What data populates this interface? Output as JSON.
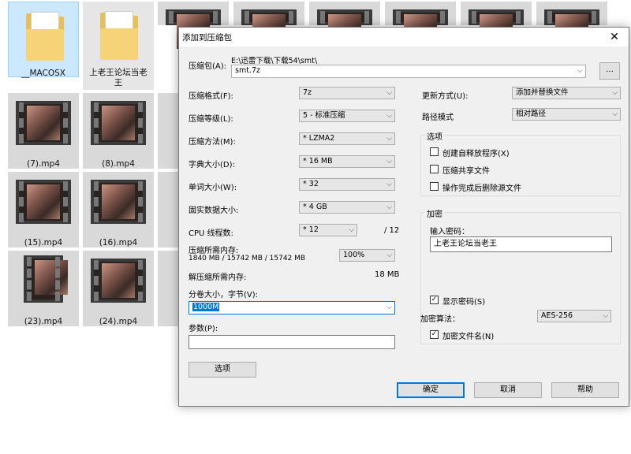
{
  "explorer": {
    "tiles": [
      {
        "name": "__MACOSX"
      },
      {
        "name": "上老王论坛当老王"
      },
      {
        "name": ""
      },
      {
        "name": ""
      },
      {
        "name": ""
      },
      {
        "name": ""
      },
      {
        "name": ""
      },
      {
        "name": ""
      },
      {
        "name": "(7).mp4"
      },
      {
        "name": "(8).mp4"
      },
      {
        "name": "(15).mp4"
      },
      {
        "name": "(16).mp4"
      },
      {
        "name": "(23).mp4"
      },
      {
        "name": "(24).mp4"
      }
    ]
  },
  "dialog": {
    "title": "添加到压缩包",
    "close_glyph": "✕",
    "archive_label": "压缩包(A):",
    "archive_path": "E:\\迅雷下载\\下载54\\smt\\",
    "archive_name": "smt.7z",
    "browse_label": "...",
    "format_label": "压缩格式(F):",
    "format_value": "7z",
    "level_label": "压缩等级(L):",
    "level_value": "5 - 标准压缩",
    "method_label": "压缩方法(M):",
    "method_value": "* LZMA2",
    "dict_label": "字典大小(D):",
    "dict_value": "* 16 MB",
    "word_label": "单词大小(W):",
    "word_value": "* 32",
    "solid_label": "固实数据大小:",
    "solid_value": "* 4 GB",
    "threads_label": "CPU 线程数:",
    "threads_value": "* 12",
    "threads_total": "/ 12",
    "mem_label": "压缩所需内存:",
    "mem_detail": "1840 MB / 15742 MB / 15742 MB",
    "mem_percent": "100%",
    "decomp_label": "解压缩所需内存:",
    "decomp_value": "18 MB",
    "split_label": "分卷大小，字节(V):",
    "split_value": "1000M",
    "params_label": "参数(P):",
    "params_value": "",
    "options_button": "选项",
    "update_label": "更新方式(U):",
    "update_value": "添加并替换文件",
    "path_label": "路径模式",
    "path_value": "相对路径",
    "options_group": "选项",
    "opt_sfx": "创建自释放程序(X)",
    "opt_shared": "压缩共享文件",
    "opt_delete": "操作完成后删除源文件",
    "encrypt_group": "加密",
    "password_label": "输入密码：",
    "password_value": "上老王论坛当老王",
    "show_password": "显示密码(S)",
    "enc_method_label": "加密算法：",
    "enc_method_value": "AES-256",
    "encrypt_names": "加密文件名(N)",
    "ok": "确定",
    "cancel": "取消",
    "help": "帮助",
    "check_mark": "✓",
    "dropdown_glyph": "⌵"
  }
}
